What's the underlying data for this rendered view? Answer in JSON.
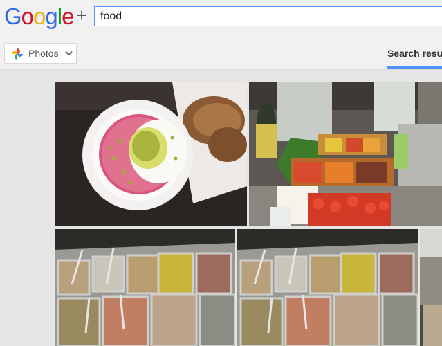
{
  "header": {
    "logo_letters": [
      "G",
      "o",
      "o",
      "g",
      "l",
      "e"
    ],
    "logo_plus": "+",
    "search": {
      "value": "food",
      "placeholder": ""
    }
  },
  "subbar": {
    "filter_label": "Photos",
    "results_tab_label": "Search resul"
  },
  "photos": [
    {
      "name": "beet-dip-with-bread",
      "icon": "photo"
    },
    {
      "name": "vegetable-market-stall",
      "icon": "photo"
    },
    {
      "name": "buffet-trays-1",
      "icon": "photo"
    },
    {
      "name": "buffet-trays-2",
      "icon": "photo"
    },
    {
      "name": "buffet-trays-3",
      "icon": "photo"
    }
  ],
  "colors": {
    "accent": "#4d90fe",
    "page_bg": "#e5e5e5",
    "bar_bg": "#f1f1f1"
  }
}
